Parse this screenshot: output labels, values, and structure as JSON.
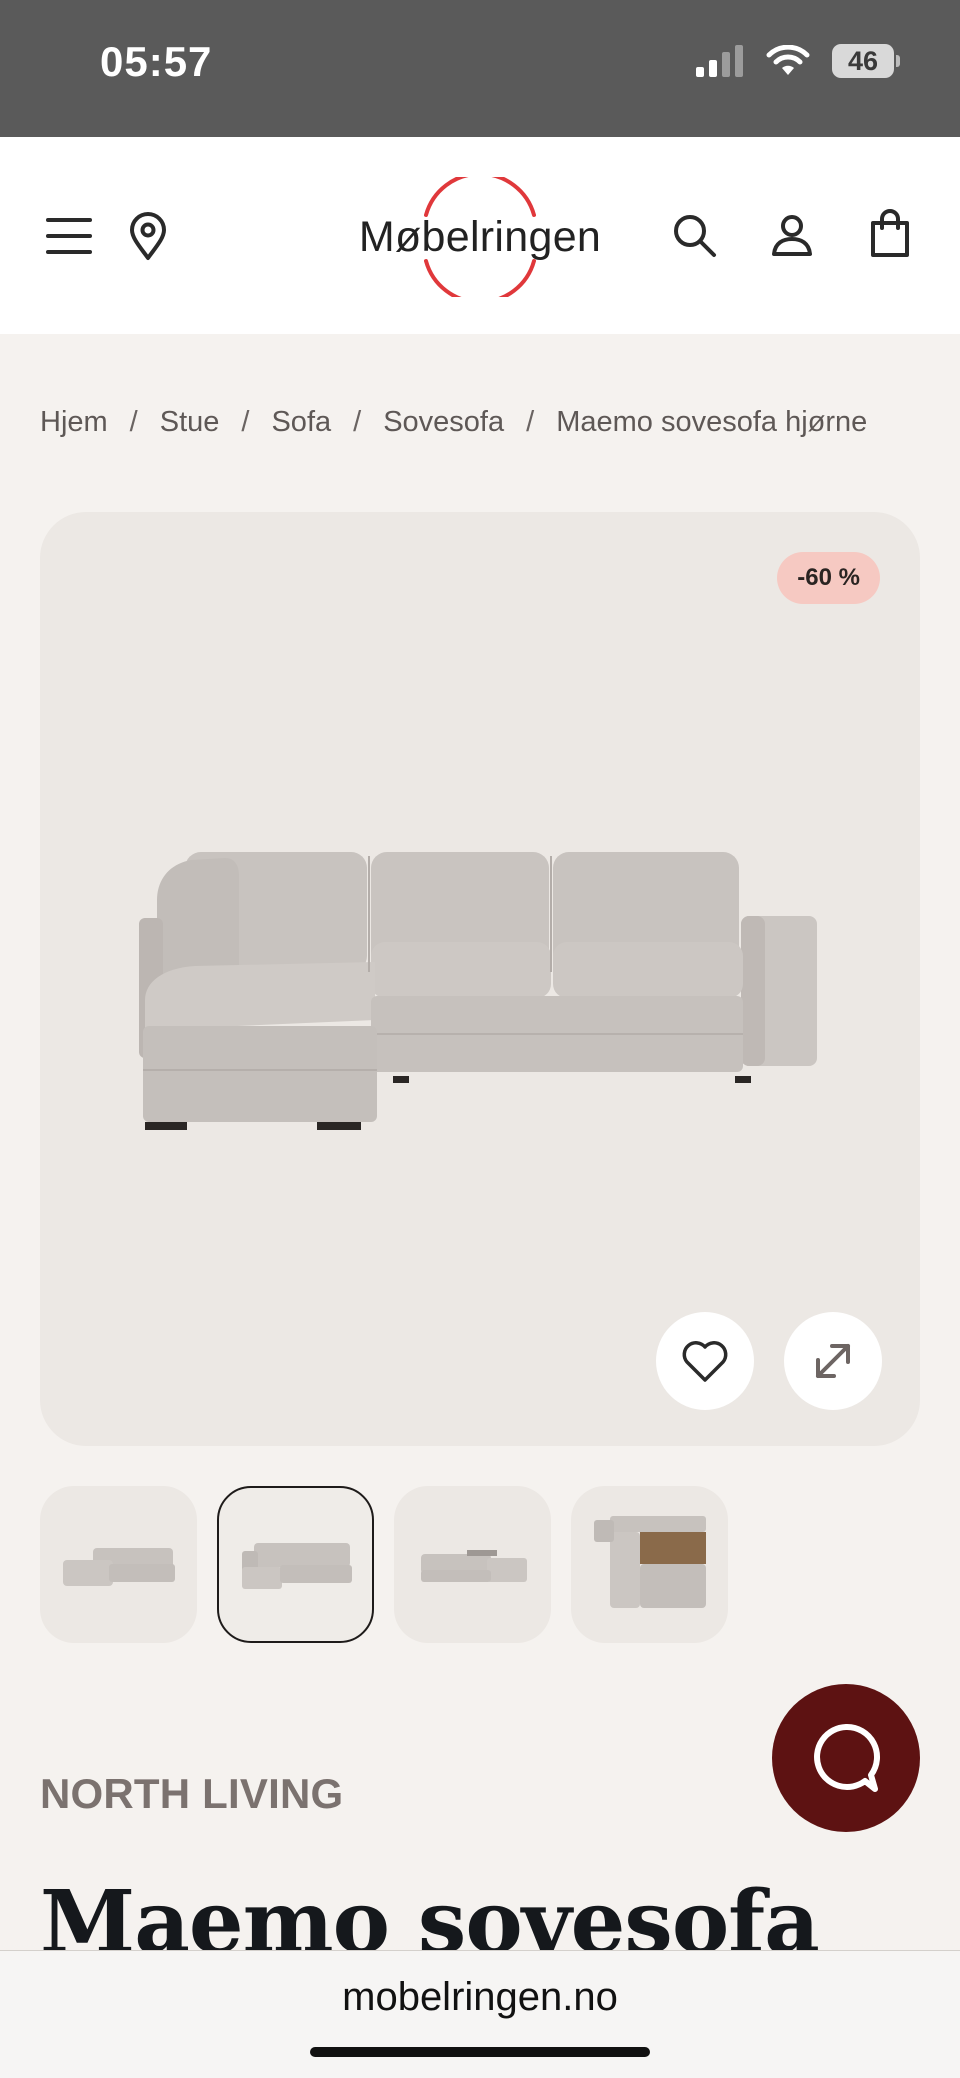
{
  "status_bar": {
    "time": "05:57",
    "battery": "46",
    "icons": [
      "signal-icon",
      "wifi-icon",
      "battery-icon"
    ]
  },
  "header": {
    "logo_text": "Møbelringen",
    "brand_color": "#e0383b",
    "icons": [
      "menu-icon",
      "location-pin-icon",
      "search-icon",
      "user-icon",
      "shopping-bag-icon"
    ]
  },
  "breadcrumb": {
    "items": [
      "Hjem",
      "Stue",
      "Sofa",
      "Sovesofa",
      "Maemo sovesofa hjørne"
    ],
    "separator": "/"
  },
  "gallery": {
    "discount_badge": "-60 %",
    "badge_color": "#f6c9c2",
    "actions": [
      "heart-icon",
      "expand-icon"
    ],
    "thumbnail_count": 4,
    "active_thumbnail": 2
  },
  "product": {
    "brand": "NORTH LIVING",
    "title": "Maemo sovesofa"
  },
  "chat": {
    "icon": "chat-icon",
    "color": "#5d1212"
  },
  "browser": {
    "url": "mobelringen.no"
  }
}
